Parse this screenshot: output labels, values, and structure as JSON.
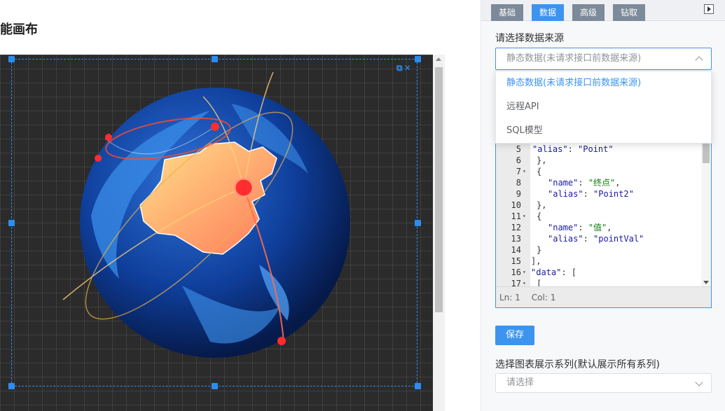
{
  "canvas": {
    "title": "能画布"
  },
  "tabs": [
    {
      "label": "基础",
      "active": false
    },
    {
      "label": "数据",
      "active": true
    },
    {
      "label": "高级",
      "active": false
    },
    {
      "label": "钻取",
      "active": false
    }
  ],
  "data_source": {
    "label": "请选择数据来源",
    "selected": "静态数据(未请求接口前数据来源)",
    "options": [
      {
        "label": "静态数据(未请求接口前数据来源)",
        "selected": true
      },
      {
        "label": "远程API",
        "selected": false
      },
      {
        "label": "SQL模型",
        "selected": false
      }
    ]
  },
  "editor": {
    "lines": [
      {
        "n": "5",
        "fold": false,
        "text": "      \"alias\": \"Point\""
      },
      {
        "n": "6",
        "fold": false,
        "text": "    },"
      },
      {
        "n": "7",
        "fold": true,
        "text": "    {"
      },
      {
        "n": "8",
        "fold": false,
        "text": "      \"name\": \"终点\","
      },
      {
        "n": "9",
        "fold": false,
        "text": "      \"alias\": \"Point2\""
      },
      {
        "n": "10",
        "fold": false,
        "text": "    },"
      },
      {
        "n": "11",
        "fold": true,
        "text": "    {"
      },
      {
        "n": "12",
        "fold": false,
        "text": "      \"name\": \"值\","
      },
      {
        "n": "13",
        "fold": false,
        "text": "      \"alias\": \"pointVal\""
      },
      {
        "n": "14",
        "fold": false,
        "text": "    }"
      },
      {
        "n": "15",
        "fold": false,
        "text": "  ],"
      },
      {
        "n": "16",
        "fold": true,
        "text": "  \"data\": ["
      },
      {
        "n": "17",
        "fold": true,
        "text": "    ["
      }
    ],
    "status_ln": "Ln: 1",
    "status_col": "Col: 1"
  },
  "save_button": "保存",
  "series": {
    "label": "选择图表展示系列(默认展示所有系列)",
    "placeholder": "请选择"
  },
  "colors": {
    "accent": "#3d94ef",
    "tab_inactive": "#7c8a99"
  }
}
